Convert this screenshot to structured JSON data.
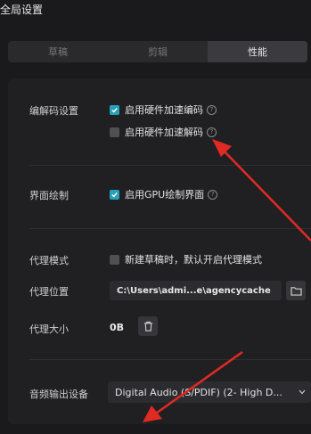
{
  "window": {
    "title": "全局设置"
  },
  "tabs": [
    {
      "label": "草稿",
      "active": false
    },
    {
      "label": "剪辑",
      "active": false
    },
    {
      "label": "性能",
      "active": true
    }
  ],
  "codec": {
    "label": "编解码设置",
    "options": [
      {
        "label": "启用硬件加速编码",
        "checked": true
      },
      {
        "label": "启用硬件加速解码",
        "checked": false
      }
    ]
  },
  "render": {
    "label": "界面绘制",
    "option": {
      "label": "启用GPU绘制界面",
      "checked": true
    }
  },
  "proxy": {
    "mode_label": "代理模式",
    "mode_option": {
      "label": "新建草稿时，默认开启代理模式",
      "checked": false
    },
    "location_label": "代理位置",
    "location_value": "C:\\Users\\admi...e\\agencycache",
    "size_label": "代理大小",
    "size_value": "0B"
  },
  "audio": {
    "label": "音频输出设备",
    "selected": "Digital Audio (S/PDIF) (2- High D..."
  },
  "colors": {
    "accent": "#27a0b8",
    "annotation_arrow": "#e02a24"
  },
  "help_glyph": "?"
}
